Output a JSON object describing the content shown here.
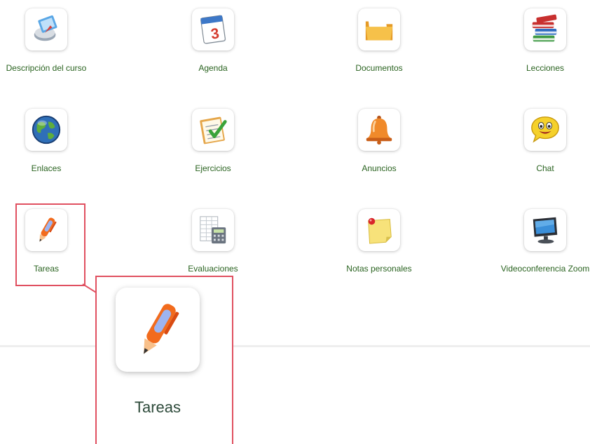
{
  "tools": [
    {
      "id": "descripcion",
      "label": "Descripción del curso",
      "icon": "course-description-icon"
    },
    {
      "id": "agenda",
      "label": "Agenda",
      "icon": "calendar-icon"
    },
    {
      "id": "documentos",
      "label": "Documentos",
      "icon": "folder-icon"
    },
    {
      "id": "lecciones",
      "label": "Lecciones",
      "icon": "books-icon"
    },
    {
      "id": "enlaces",
      "label": "Enlaces",
      "icon": "globe-icon"
    },
    {
      "id": "ejercicios",
      "label": "Ejercicios",
      "icon": "checklist-icon"
    },
    {
      "id": "anuncios",
      "label": "Anuncios",
      "icon": "bell-icon"
    },
    {
      "id": "chat",
      "label": "Chat",
      "icon": "smiley-chat-icon"
    },
    {
      "id": "tareas",
      "label": "Tareas",
      "icon": "pen-icon"
    },
    {
      "id": "evaluaciones",
      "label": "Evaluaciones",
      "icon": "calculator-icon"
    },
    {
      "id": "notas",
      "label": "Notas personales",
      "icon": "sticky-note-icon"
    },
    {
      "id": "zoom",
      "label": "Videoconferencia Zoom",
      "icon": "monitor-icon"
    }
  ],
  "zoom_callout": {
    "label": "Tareas",
    "icon": "pen-icon"
  },
  "colors": {
    "label": "#2a6320",
    "highlight": "#e05060",
    "callout_label": "#2d4a3a"
  },
  "calendar_day": "3"
}
